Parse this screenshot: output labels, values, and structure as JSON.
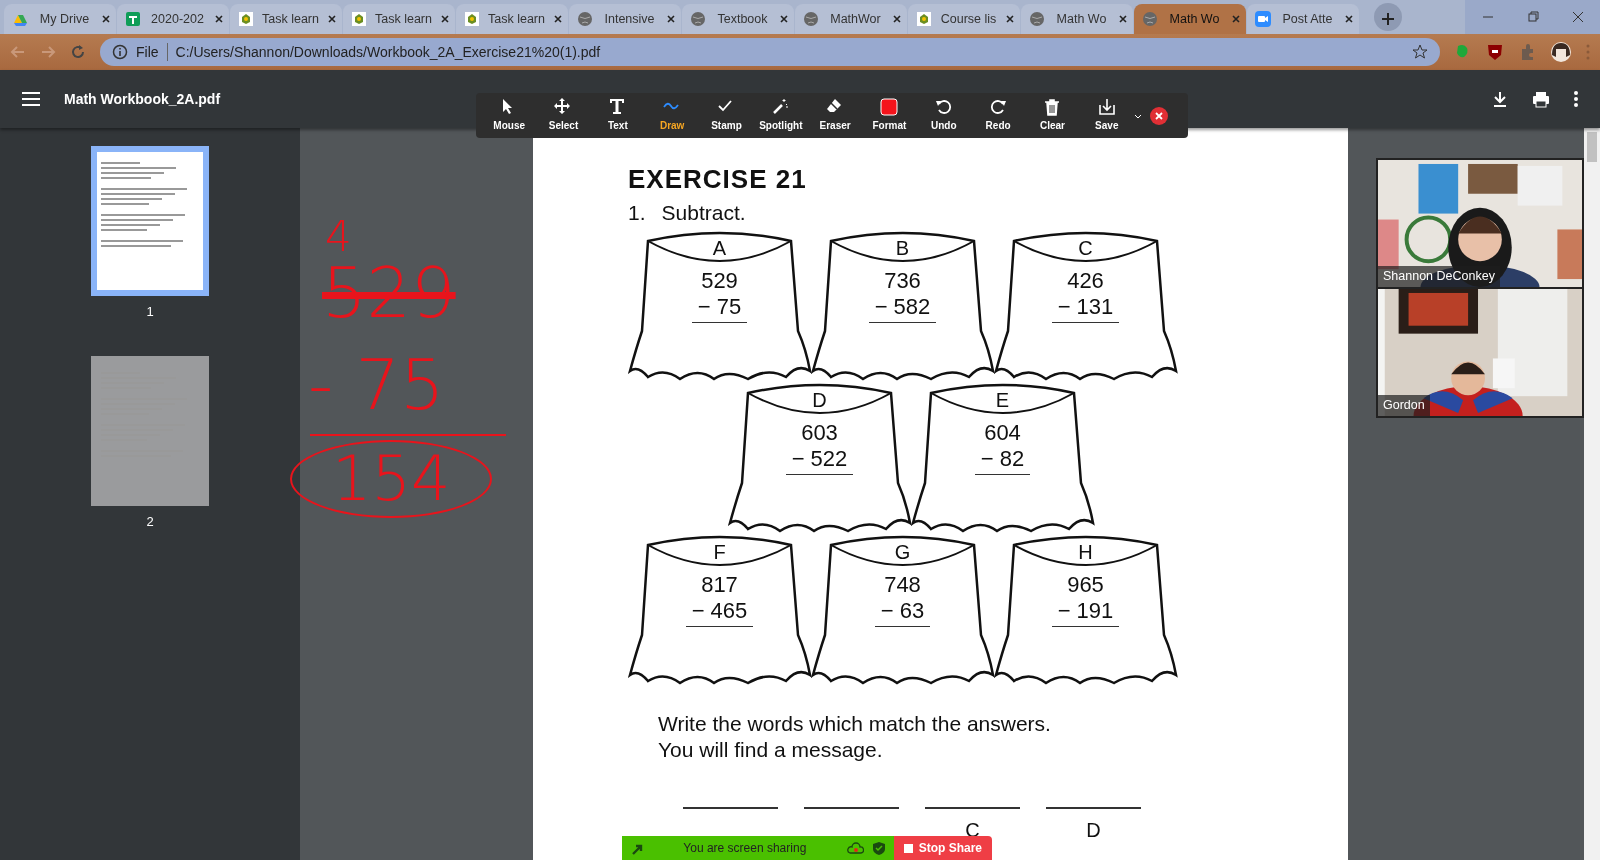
{
  "browser": {
    "tabs": [
      {
        "title": "My Drive",
        "selected": false
      },
      {
        "title": "2020-202",
        "selected": false
      },
      {
        "title": "Task learn",
        "selected": false
      },
      {
        "title": "Task learn",
        "selected": false
      },
      {
        "title": "Task learn",
        "selected": false
      },
      {
        "title": "Intensive",
        "selected": false
      },
      {
        "title": "Textbook",
        "selected": false
      },
      {
        "title": "MathWor",
        "selected": false
      },
      {
        "title": "Course lis",
        "selected": false
      },
      {
        "title": "Math Wo",
        "selected": false
      },
      {
        "title": "Math Wo",
        "selected": true
      },
      {
        "title": "Post Atte",
        "selected": false
      }
    ],
    "address": {
      "scheme": "File",
      "url": "C:/Users/Shannon/Downloads/Workbook_2A_Exercise21%20(1).pdf"
    }
  },
  "viewer": {
    "title": "Math Workbook_2A.pdf",
    "thumbnails": [
      {
        "page": "1",
        "selected": true
      },
      {
        "page": "2",
        "selected": false
      }
    ]
  },
  "annotation_toolbar": {
    "tools": [
      {
        "label": "Mouse",
        "selected": false
      },
      {
        "label": "Select",
        "selected": false
      },
      {
        "label": "Text",
        "selected": false
      },
      {
        "label": "Draw",
        "selected": true
      },
      {
        "label": "Stamp",
        "selected": false
      },
      {
        "label": "Spotlight",
        "selected": false
      },
      {
        "label": "Eraser",
        "selected": false
      },
      {
        "label": "Format",
        "selected": false
      },
      {
        "label": "Undo",
        "selected": false
      },
      {
        "label": "Redo",
        "selected": false
      },
      {
        "label": "Clear",
        "selected": false
      },
      {
        "label": "Save",
        "selected": false
      }
    ]
  },
  "document": {
    "heading": "EXERCISE 21",
    "question_number": "1.",
    "instruction": "Subtract.",
    "stump_rows": [
      [
        {
          "letter": "A",
          "minuend": "529",
          "subtrahend": "−  75"
        },
        {
          "letter": "B",
          "minuend": "736",
          "subtrahend": "− 582"
        },
        {
          "letter": "C",
          "minuend": "426",
          "subtrahend": "− 131"
        }
      ],
      [
        {
          "letter": "D",
          "minuend": "603",
          "subtrahend": "− 522"
        },
        {
          "letter": "E",
          "minuend": "604",
          "subtrahend": "−  82"
        }
      ],
      [
        {
          "letter": "F",
          "minuend": "817",
          "subtrahend": "− 465"
        },
        {
          "letter": "G",
          "minuend": "748",
          "subtrahend": "−  63"
        },
        {
          "letter": "H",
          "minuend": "965",
          "subtrahend": "− 191"
        }
      ]
    ],
    "message_prompt": "Write the words which match the answers.\nYou will find a message.",
    "answer_blanks": [
      {
        "kind": "line"
      },
      {
        "kind": "line"
      },
      {
        "kind": "lettered",
        "letter": "C"
      },
      {
        "kind": "lettered",
        "letter": "D"
      }
    ]
  },
  "ink_annotations": [
    {
      "text": "4",
      "struck": false,
      "circled": false
    },
    {
      "text": "529",
      "struck": true,
      "circled": false
    },
    {
      "text": "- 75",
      "struck": false,
      "circled": false
    },
    {
      "text": "154",
      "struck": false,
      "circled": true
    }
  ],
  "participants": [
    {
      "name": "Shannon DeConkey"
    },
    {
      "name": "Gordon"
    }
  ],
  "share_bar": {
    "status": "You are screen sharing",
    "stop_label": "Stop Share"
  }
}
